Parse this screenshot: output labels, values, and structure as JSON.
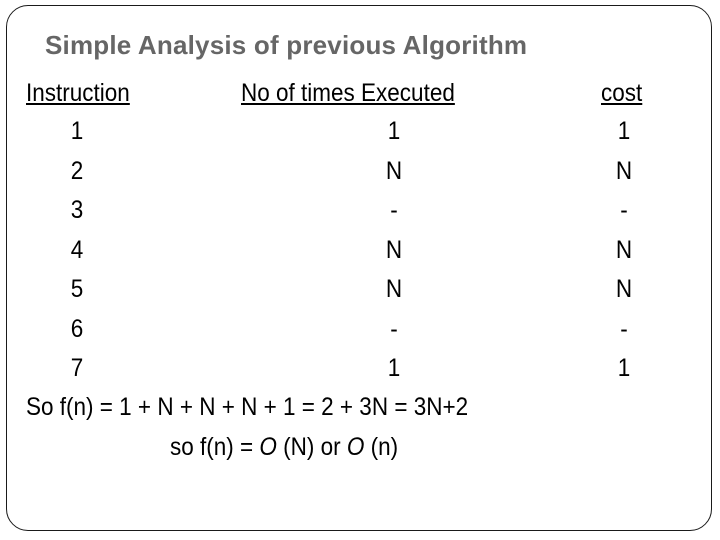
{
  "title": "Simple Analysis of previous Algorithm",
  "table": {
    "headers": [
      "Instruction",
      "No of times Executed",
      "cost"
    ],
    "rows": [
      [
        "1",
        "1",
        "1"
      ],
      [
        "2",
        "N",
        "N"
      ],
      [
        "3",
        "-",
        "-"
      ],
      [
        "4",
        "N",
        "N"
      ],
      [
        "5",
        "N",
        "N"
      ],
      [
        "6",
        "-",
        "-"
      ],
      [
        "7",
        "1",
        "1"
      ]
    ]
  },
  "formula": {
    "line1": "So f(n) = 1 + N + N + N + 1 = 2 + 3N = 3N+2",
    "line2_prefix": "so f(n) = ",
    "line2_o1": "O",
    "line2_mid": " (N) or ",
    "line2_o2": "O",
    "line2_suffix": " (n)"
  }
}
